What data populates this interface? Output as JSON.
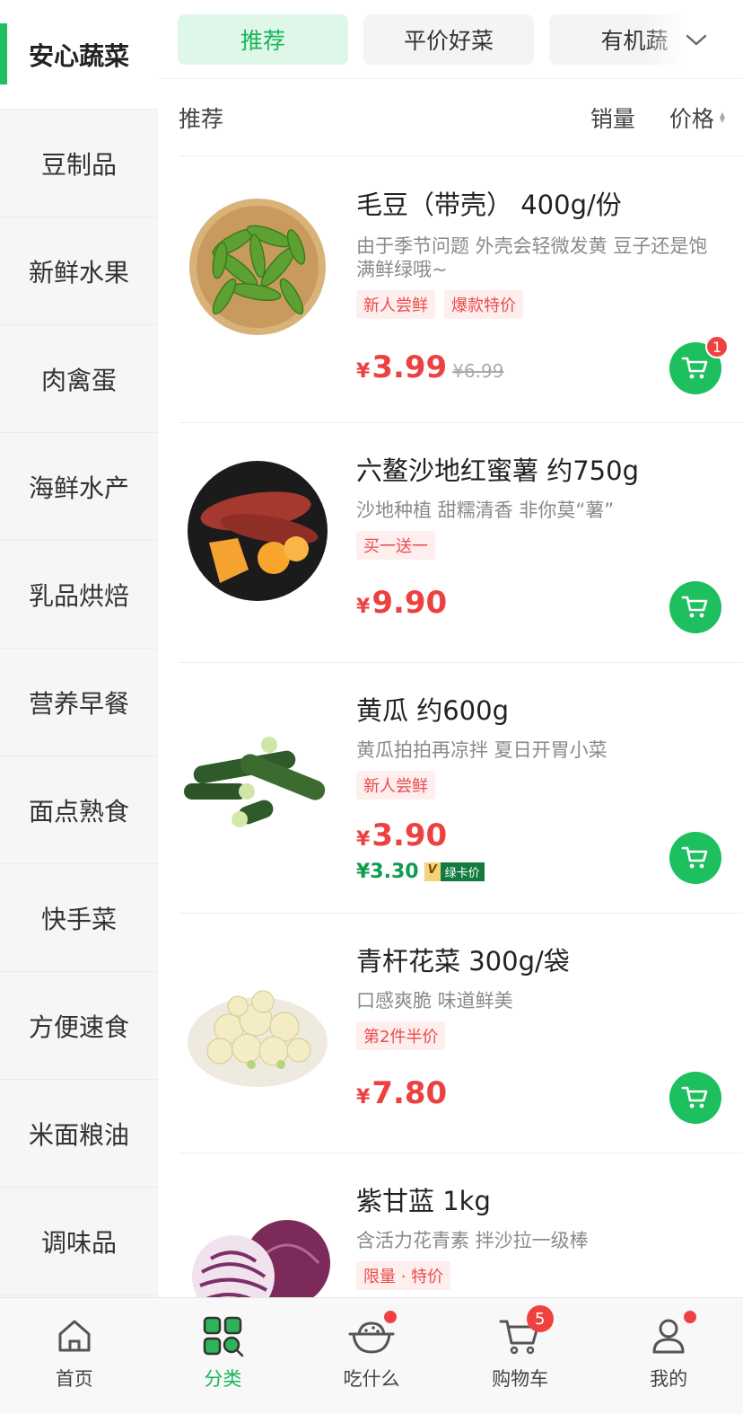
{
  "sidebar": {
    "items": [
      {
        "label": "安心蔬菜"
      },
      {
        "label": "豆制品"
      },
      {
        "label": "新鲜水果"
      },
      {
        "label": "肉禽蛋"
      },
      {
        "label": "海鲜水产"
      },
      {
        "label": "乳品烘焙"
      },
      {
        "label": "营养早餐"
      },
      {
        "label": "面点熟食"
      },
      {
        "label": "快手菜"
      },
      {
        "label": "方便速食"
      },
      {
        "label": "米面粮油"
      },
      {
        "label": "调味品"
      }
    ],
    "active_index": 0
  },
  "tabs": {
    "items": [
      {
        "label": "推荐"
      },
      {
        "label": "平价好菜"
      },
      {
        "label": "有机蔬"
      }
    ],
    "active_index": 0,
    "expand_icon": "chevron-down-icon"
  },
  "sortbar": {
    "recommend": "推荐",
    "sales": "销量",
    "price": "价格"
  },
  "products": [
    {
      "name": "毛豆（带壳） 400g/份",
      "desc": "由于季节问题 外壳会轻微发黄 豆子还是饱满鲜绿哦~",
      "tags": [
        "新人尝鲜",
        "爆款特价"
      ],
      "currency": "¥",
      "price": "3.99",
      "old_price": "¥6.99",
      "cart_badge": "1",
      "image": "edamame"
    },
    {
      "name": "六鳌沙地红蜜薯 约750g",
      "desc": "沙地种植 甜糯清香 非你莫“薯”",
      "tags": [
        "买一送一"
      ],
      "currency": "¥",
      "price": "9.90",
      "image": "sweet-potato"
    },
    {
      "name": "黄瓜 约600g",
      "desc": "黄瓜拍拍再凉拌 夏日开胃小菜",
      "tags": [
        "新人尝鲜"
      ],
      "currency": "¥",
      "price": "3.90",
      "member_price": "¥3.30",
      "member_v": "V",
      "member_label": "绿卡价",
      "image": "cucumber"
    },
    {
      "name": "青杆花菜 300g/袋",
      "desc": "口感爽脆 味道鲜美",
      "tags": [
        "第2件半价"
      ],
      "currency": "¥",
      "price": "7.80",
      "image": "cauliflower"
    },
    {
      "name": "紫甘蓝 1kg",
      "desc": "含活力花青素 拌沙拉一级棒",
      "tags": [
        "限量 · 特价"
      ],
      "image": "red-cabbage"
    }
  ],
  "bottom_nav": {
    "items": [
      {
        "label": "首页",
        "icon": "home-icon"
      },
      {
        "label": "分类",
        "icon": "category-icon"
      },
      {
        "label": "吃什么",
        "icon": "bowl-icon"
      },
      {
        "label": "购物车",
        "icon": "cart-icon",
        "badge": "5"
      },
      {
        "label": "我的",
        "icon": "profile-icon"
      }
    ],
    "active_index": 1
  },
  "colors": {
    "brand_green": "#1dbf5e",
    "price_red": "#ec4141",
    "member_green": "#0f9d4f"
  }
}
